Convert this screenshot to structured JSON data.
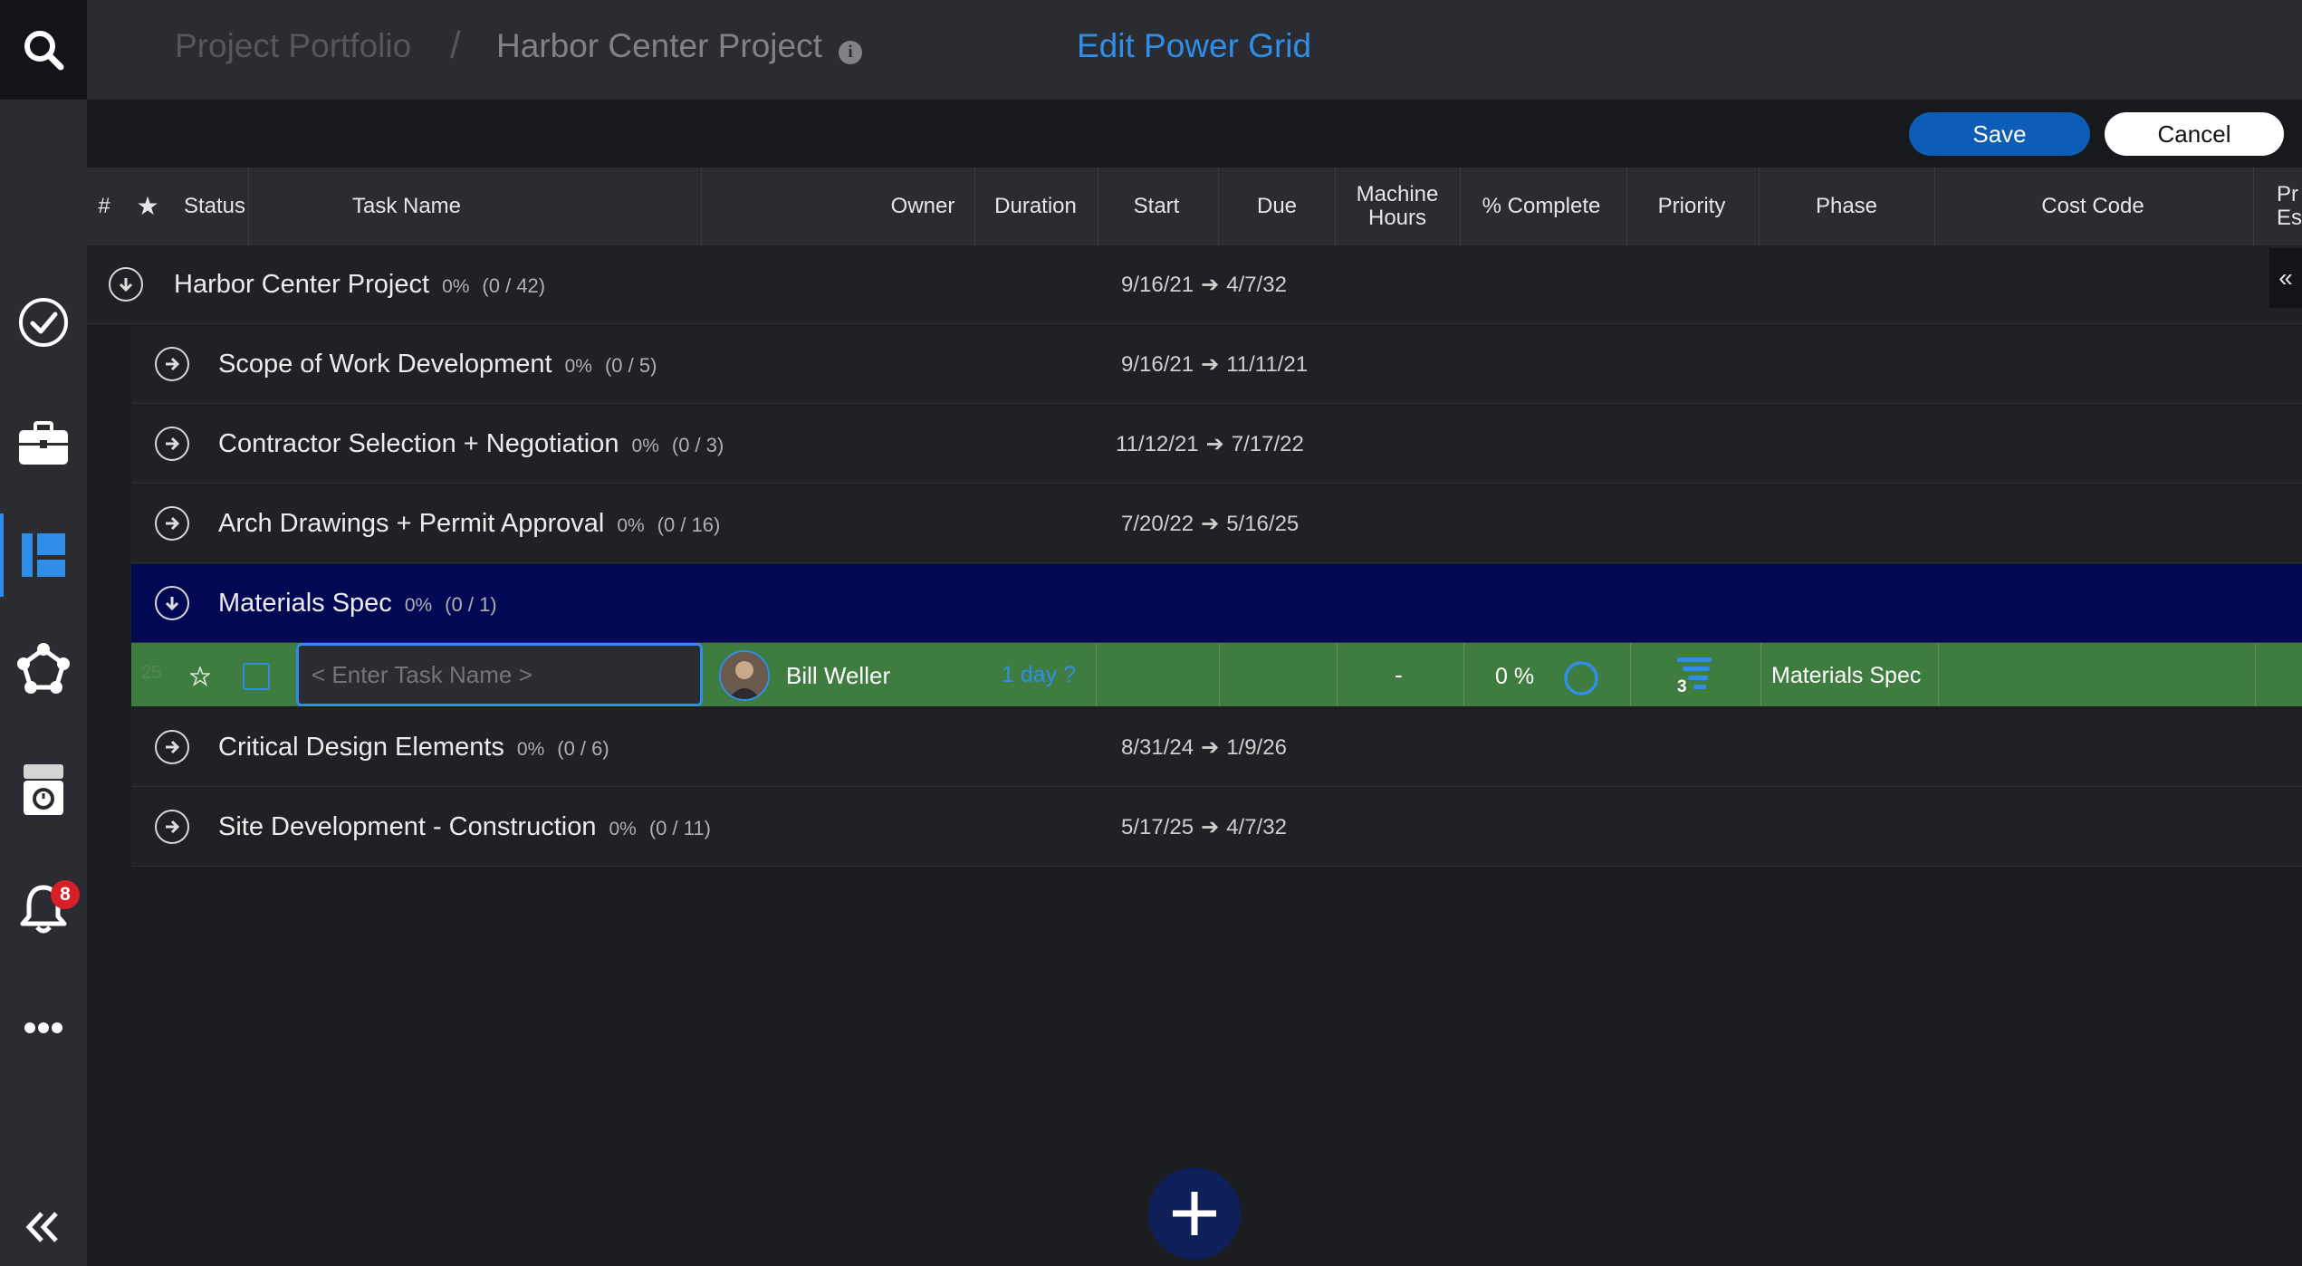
{
  "header": {
    "breadcrumb_root": "Project Portfolio",
    "breadcrumb_sep": "/",
    "breadcrumb_project": "Harbor Center Project",
    "info_glyph": "i",
    "title": "Edit Power Grid"
  },
  "actions": {
    "save": "Save",
    "cancel": "Cancel"
  },
  "sidebar": {
    "icons": [
      "search-icon",
      "check-circle-icon",
      "briefcase-icon",
      "board-icon",
      "network-icon",
      "timesheet-icon",
      "bell-icon",
      "more-icon",
      "collapse-left-icon"
    ],
    "notifications": "8"
  },
  "columns": {
    "num": "#",
    "star": "★",
    "status": "Status",
    "task": "Task Name",
    "owner": "Owner",
    "duration": "Duration",
    "start": "Start",
    "due": "Due",
    "machine_1": "Machine",
    "machine_2": "Hours",
    "complete": "% Complete",
    "priority": "Priority",
    "phase": "Phase",
    "cost": "Cost Code",
    "extra_1": "Pr",
    "extra_2": "Es"
  },
  "rows": [
    {
      "name": "Harbor Center Project",
      "pct": "0%",
      "count": "(0 / 42)",
      "start": "9/16/21",
      "due": "4/7/32"
    },
    {
      "name": "Scope of Work Development",
      "pct": "0%",
      "count": "(0 / 5)",
      "start": "9/16/21",
      "due": "11/11/21"
    },
    {
      "name": "Contractor Selection + Negotiation",
      "pct": "0%",
      "count": "(0 / 3)",
      "start": "11/12/21",
      "due": "7/17/22"
    },
    {
      "name": "Arch Drawings + Permit Approval",
      "pct": "0%",
      "count": "(0 / 16)",
      "start": "7/20/22",
      "due": "5/16/25"
    },
    {
      "name": "Materials Spec",
      "pct": "0%",
      "count": "(0 / 1)",
      "start": "",
      "due": ""
    },
    {
      "name": "Critical Design Elements",
      "pct": "0%",
      "count": "(0 / 6)",
      "start": "8/31/24",
      "due": "1/9/26"
    },
    {
      "name": "Site Development - Construction",
      "pct": "0%",
      "count": "(0 / 11)",
      "start": "5/17/25",
      "due": "4/7/32"
    }
  ],
  "arrow": "➔",
  "new_task": {
    "row_number": "25",
    "placeholder": "< Enter Task Name >",
    "owner": "Bill Weller",
    "duration": "1 day ?",
    "machine_hours": "-",
    "complete": "0 %",
    "priority_level": "3",
    "phase": "Materials Spec"
  },
  "collapse_glyph": "«",
  "colors": {
    "accent": "#2f8ee8",
    "save": "#0d5db8",
    "new_row": "#3e7d3f",
    "selected_row": "#030855",
    "badge": "#d81f26"
  }
}
